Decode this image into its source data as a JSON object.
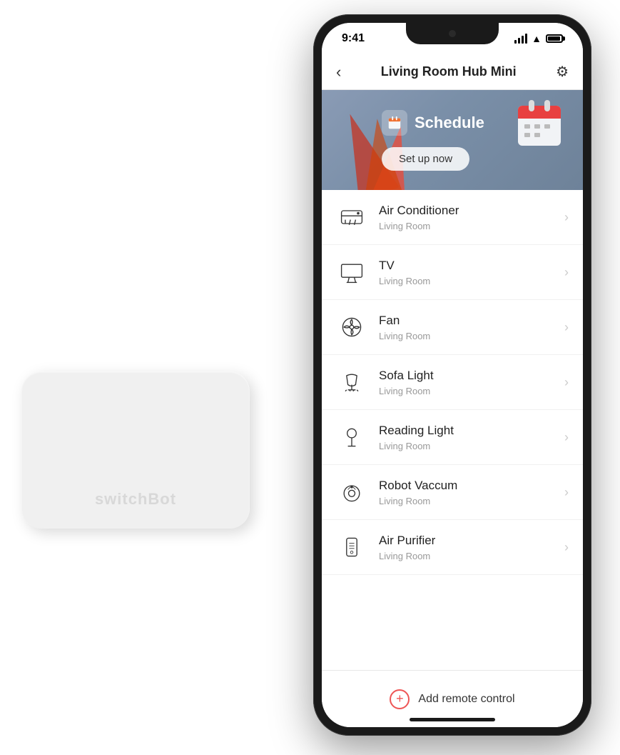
{
  "brand": "switchBot",
  "status_bar": {
    "time": "9:41"
  },
  "header": {
    "title": "Living Room Hub Mini",
    "back_label": "‹",
    "settings_label": "⚙"
  },
  "schedule": {
    "label": "Schedule",
    "setup_button": "Set up now"
  },
  "devices": [
    {
      "name": "Air Conditioner",
      "room": "Living Room",
      "icon": "ac"
    },
    {
      "name": "TV",
      "room": "Living Room",
      "icon": "tv"
    },
    {
      "name": "Fan",
      "room": "Living Room",
      "icon": "fan"
    },
    {
      "name": "Sofa Light",
      "room": "Living Room",
      "icon": "light"
    },
    {
      "name": "Reading Light",
      "room": "Living Room",
      "icon": "readinglight"
    },
    {
      "name": "Robot Vaccum",
      "room": "Living Room",
      "icon": "robot"
    },
    {
      "name": "Air Purifier",
      "room": "Living Room",
      "icon": "purifier"
    }
  ],
  "add_remote": {
    "label": "Add remote control"
  }
}
